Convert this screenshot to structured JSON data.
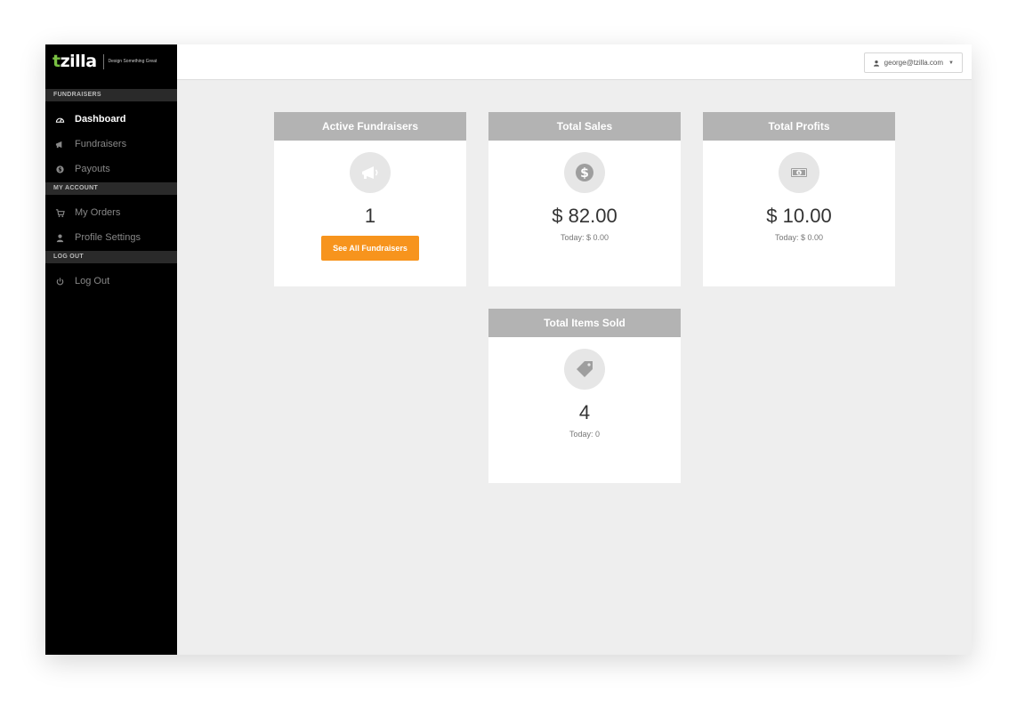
{
  "brand": {
    "logo_text": "tzilla",
    "logo_t": "t",
    "logo_rest": "zilla",
    "tagline": "Design Something Great"
  },
  "sidebar": {
    "sections": [
      {
        "title": "FUNDRAISERS",
        "items": [
          {
            "label": "Dashboard",
            "icon": "dashboard-icon",
            "active": true
          },
          {
            "label": "Fundraisers",
            "icon": "megaphone-icon"
          },
          {
            "label": "Payouts",
            "icon": "payout-icon"
          }
        ]
      },
      {
        "title": "MY ACCOUNT",
        "items": [
          {
            "label": "My Orders",
            "icon": "cart-icon"
          },
          {
            "label": "Profile Settings",
            "icon": "user-icon"
          }
        ]
      },
      {
        "title": "LOG OUT",
        "items": [
          {
            "label": "Log Out",
            "icon": "power-icon"
          }
        ]
      }
    ]
  },
  "topbar": {
    "user_email": "george@tzilla.com",
    "caret": "▼"
  },
  "cards": {
    "active_fundraisers": {
      "title": "Active Fundraisers",
      "icon": "megaphone-icon",
      "value": "1",
      "button_label": "See All Fundraisers"
    },
    "total_sales": {
      "title": "Total Sales",
      "icon": "dollar-icon",
      "value": "$ 82.00",
      "today": "Today: $ 0.00"
    },
    "total_profits": {
      "title": "Total Profits",
      "icon": "cash-icon",
      "value": "$ 10.00",
      "today": "Today: $ 0.00"
    },
    "total_items_sold": {
      "title": "Total Items Sold",
      "icon": "tag-icon",
      "value": "4",
      "today": "Today: 0"
    }
  },
  "colors": {
    "sidebar_bg": "#000000",
    "brand_green": "#7ac143",
    "accent_orange": "#f7941d",
    "card_header": "#b3b3b3",
    "content_bg": "#eeeeee"
  }
}
